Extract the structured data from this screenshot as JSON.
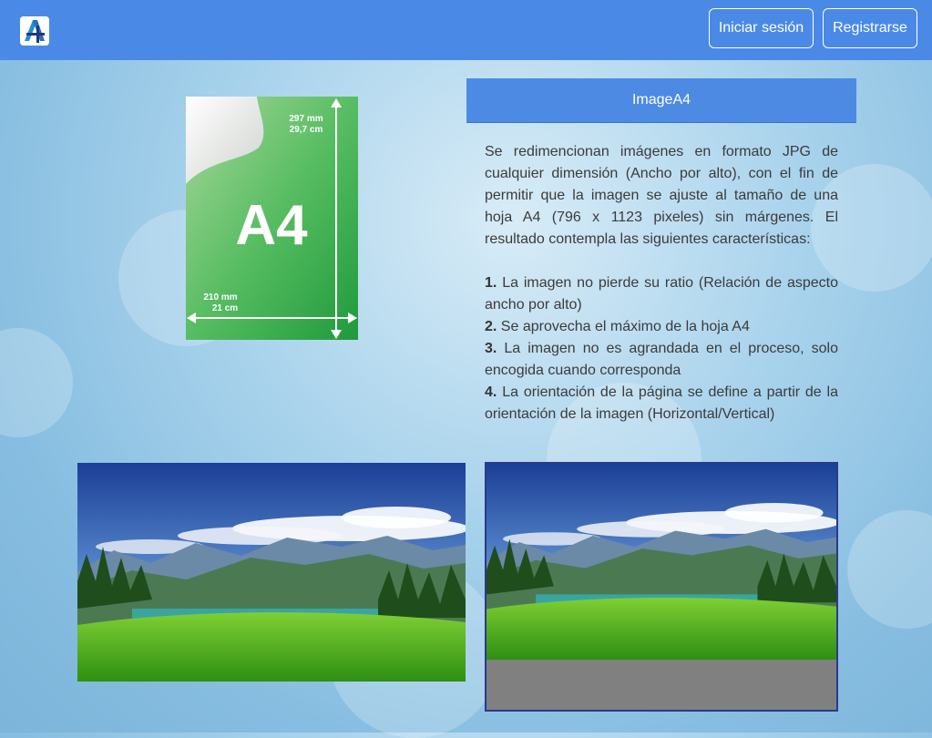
{
  "navbar": {
    "logo_text": "4",
    "login_label": "Iniciar sesión",
    "register_label": "Registrarse"
  },
  "a4_graphic": {
    "label": "A4",
    "height_mm": "297 mm",
    "height_cm": "29,7 cm",
    "width_mm": "210 mm",
    "width_cm": "21 cm"
  },
  "panel": {
    "title": "ImageA4",
    "intro": "Se redimencionan imágenes en formato JPG de cualquier dimensión (Ancho por alto), con el fin de permitir que la imagen se ajuste al tamaño de una hoja A4 (796 x 1123 pixeles) sin márgenes. El resultado contempla las siguientes características:",
    "features": [
      {
        "num": "1.",
        "text": "La imagen no pierde su ratio (Relación de aspecto ancho por alto)"
      },
      {
        "num": "2.",
        "text": "Se aprovecha el máximo de la hoja A4"
      },
      {
        "num": "3.",
        "text": "La imagen no es agrandada en el proceso, solo encogida cuando corresponda"
      },
      {
        "num": "4.",
        "text": "La orientación de la página se define a partir de la orientación de la imagen (Horizontal/Vertical)"
      }
    ]
  },
  "colors": {
    "navbar": "#4a8ae6",
    "panel_header": "#4d8ae3",
    "a4_green": "#3fb04f",
    "result_border": "#2a3a8a"
  }
}
